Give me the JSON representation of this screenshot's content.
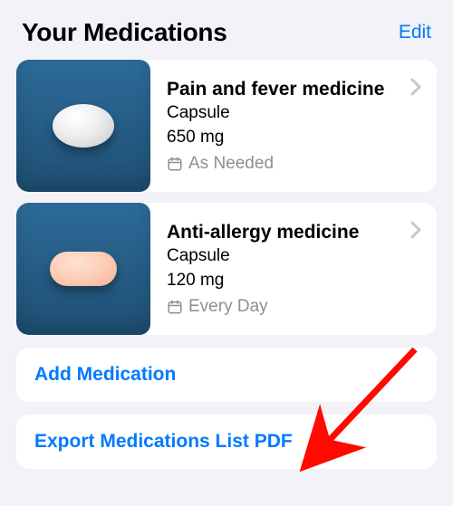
{
  "header": {
    "title": "Your Medications",
    "edit_label": "Edit"
  },
  "medications": [
    {
      "name": "Pain and fever medicine",
      "form": "Capsule",
      "strength": "650 mg",
      "schedule": "As Needed",
      "shape": "oval",
      "color": "#e9e9e9"
    },
    {
      "name": "Anti-allergy medicine",
      "form": "Capsule",
      "strength": "120 mg",
      "schedule": "Every Day",
      "shape": "capsule",
      "color": "#fbcdb6"
    }
  ],
  "actions": {
    "add_label": "Add Medication",
    "export_label": "Export Medications List PDF"
  },
  "colors": {
    "accent": "#007aff",
    "secondary_text": "#8e8e93",
    "thumb_bg": "#2b6792",
    "page_bg": "#f2f2f7",
    "annotation_arrow": "#ff0a00"
  },
  "icons": {
    "calendar": "calendar-icon",
    "chevron": "chevron-right-icon"
  }
}
